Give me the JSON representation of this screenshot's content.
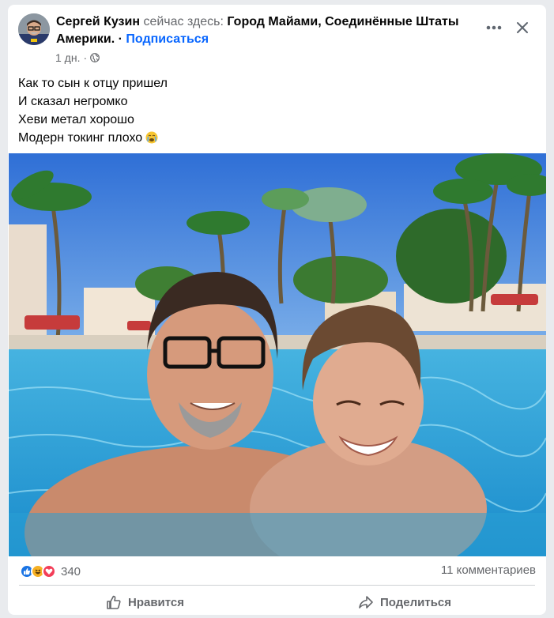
{
  "header": {
    "author_name": "Сергей Кузин",
    "status_prefix": "сейчас здесь:",
    "location": "Город Майами, Соединённые Штаты Америки",
    "separator": ". ·",
    "follow_label": "Подписаться",
    "time": "1 дн.",
    "time_separator": "·",
    "privacy_icon": "globe-icon",
    "more_icon": "more-dots-icon",
    "close_icon": "close-icon"
  },
  "post": {
    "lines": [
      "Как то сын к отцу пришел",
      "И сказал негромко",
      "Хеви метал хорошо",
      "Модерн токинг плохо"
    ],
    "line_emoji_icon": "crying-face-emoji"
  },
  "photo": {
    "subject": "selfie-in-pool-icon"
  },
  "stats": {
    "reaction_icons": [
      "like-reaction-icon",
      "haha-reaction-icon",
      "love-reaction-icon"
    ],
    "reaction_count": "340",
    "comments": "11 комментариев"
  },
  "actions": {
    "like_label": "Нравится",
    "like_icon": "thumbs-up-icon",
    "share_label": "Поделиться",
    "share_icon": "share-arrow-icon"
  },
  "colors": {
    "link": "#0866ff",
    "muted": "#65676b",
    "like_blue": "#1b74e4",
    "love_red": "#f33e58",
    "haha_yellow": "#f7b125"
  }
}
